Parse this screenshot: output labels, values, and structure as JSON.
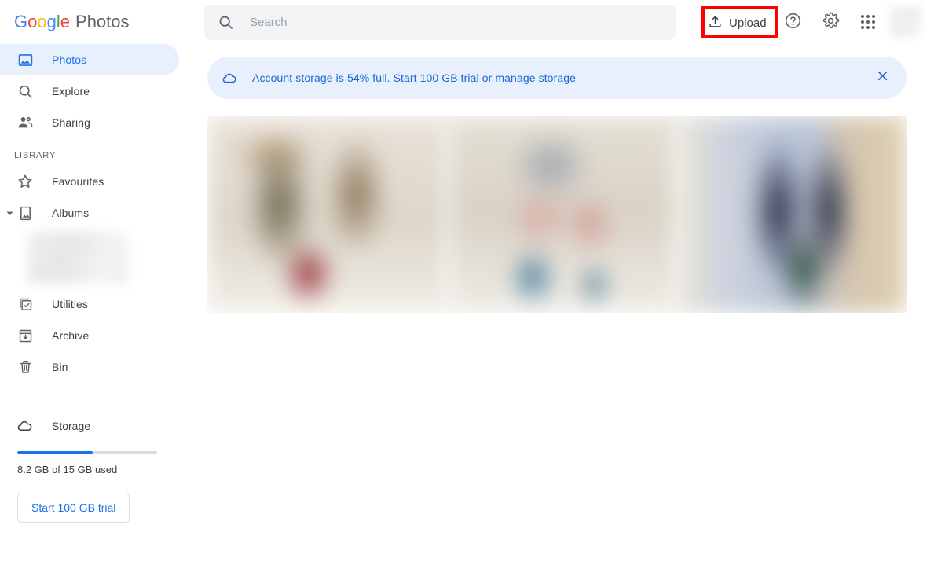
{
  "header": {
    "logo": {
      "google_letters": [
        "G",
        "o",
        "o",
        "g",
        "l",
        "e"
      ],
      "product": "Photos"
    },
    "search": {
      "placeholder": "Search",
      "value": "",
      "icon": "search-icon"
    },
    "upload": {
      "label": "Upload",
      "icon": "upload-icon",
      "highlight_color": "#FF0000"
    },
    "help": {
      "icon": "help-circle-icon"
    },
    "settings": {
      "icon": "gear-icon"
    },
    "apps": {
      "icon": "apps-grid-icon"
    },
    "avatar": {
      "icon": "avatar"
    }
  },
  "sidebar": {
    "primary_items": [
      {
        "label": "Photos",
        "icon": "photo-icon",
        "active": true
      },
      {
        "label": "Explore",
        "icon": "search-icon",
        "active": false
      },
      {
        "label": "Sharing",
        "icon": "people-icon",
        "active": false
      }
    ],
    "library_label": "LIBRARY",
    "library_items": [
      {
        "label": "Favourites",
        "icon": "star-icon"
      },
      {
        "label": "Albums",
        "icon": "album-icon"
      }
    ],
    "album_expanded": true,
    "utility_items": [
      {
        "label": "Utilities",
        "icon": "utilities-icon"
      },
      {
        "label": "Archive",
        "icon": "archive-icon"
      },
      {
        "label": "Bin",
        "icon": "trash-icon"
      }
    ],
    "storage": {
      "label": "Storage",
      "icon": "cloud-icon",
      "used_percent": 54,
      "usage_text": "8.2 GB of 15 GB used",
      "trial_button": "Start 100 GB trial",
      "fill_color": "#1A73E8"
    }
  },
  "main": {
    "banner": {
      "icon": "cloud-icon",
      "text_prefix": "Account storage is 54% full.",
      "link_trial": "Start 100 GB trial",
      "text_or": "or",
      "link_manage": "manage storage",
      "close_icon": "close-icon",
      "background_color": "#E8F0FE",
      "text_color": "#1967D2"
    },
    "photo_row": {
      "tiles": [
        "photo-thumbnail",
        "photo-thumbnail",
        "photo-thumbnail"
      ]
    }
  }
}
